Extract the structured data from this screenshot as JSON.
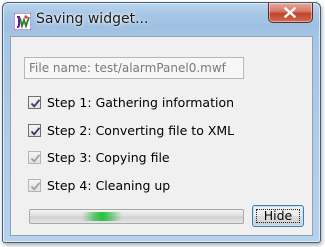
{
  "window": {
    "title": "Saving widget...",
    "app_icon": "jw-app-icon",
    "close_icon": "close-icon"
  },
  "file_name_field": {
    "value": "File name: test/alarmPanel0.mwf"
  },
  "steps": [
    {
      "label": "Step 1: Gathering information",
      "checked": true,
      "enabled": true
    },
    {
      "label": "Step 2: Converting file to XML",
      "checked": true,
      "enabled": true
    },
    {
      "label": "Step 3: Copying file",
      "checked": true,
      "enabled": false
    },
    {
      "label": "Step 4: Cleaning up",
      "checked": true,
      "enabled": false
    }
  ],
  "progress": {
    "indeterminate": true,
    "color": "#21c43d"
  },
  "hide_button": {
    "label": "Hide"
  }
}
